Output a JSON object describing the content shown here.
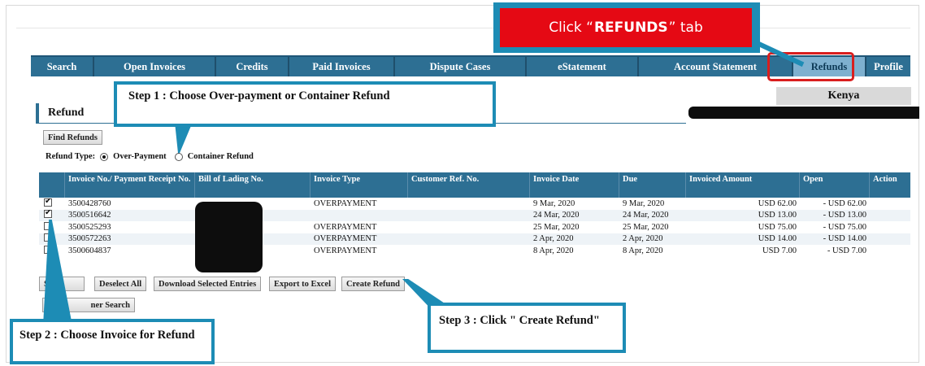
{
  "tabs": [
    "Search",
    "Open Invoices",
    "Credits",
    "Paid Invoices",
    "Dispute Cases",
    "eStatement",
    "Account Statement",
    "Refunds",
    "Profile"
  ],
  "callouts": {
    "top_prefix": "Click “",
    "top_strong": "REFUNDS",
    "top_suffix": "” tab",
    "step1": "Step 1 : Choose Over-payment or Container Refund",
    "step2": "Step 2 : Choose Invoice for Refund",
    "step3": "Step 3 : Click \" Create Refund\""
  },
  "page": {
    "title": "Refund",
    "country": "Kenya",
    "find_button": "Find Refunds",
    "refund_type_label": "Refund Type:",
    "option_overpayment": "Over-Payment",
    "option_container": "Container Refund"
  },
  "table": {
    "headers": [
      "Invoice No./ Payment Receipt No.",
      "Bill of Lading No.",
      "Invoice Type",
      "Customer Ref. No.",
      "Invoice Date",
      "Due",
      "Invoiced Amount",
      "Open",
      "Action"
    ],
    "rows": [
      {
        "checked": true,
        "invoice": "3500428760",
        "type": "OVERPAYMENT",
        "date": "9 Mar, 2020",
        "due": "9 Mar, 2020",
        "amount": "USD 62.00",
        "open": "- USD 62.00"
      },
      {
        "checked": true,
        "invoice": "3500516642",
        "type": "",
        "date": "24 Mar, 2020",
        "due": "24 Mar, 2020",
        "amount": "USD 13.00",
        "open": "- USD 13.00"
      },
      {
        "checked": false,
        "invoice": "3500525293",
        "type": "OVERPAYMENT",
        "date": "25 Mar, 2020",
        "due": "25 Mar, 2020",
        "amount": "USD 75.00",
        "open": "- USD 75.00"
      },
      {
        "checked": false,
        "invoice": "3500572263",
        "type": "OVERPAYMENT",
        "date": "2 Apr, 2020",
        "due": "2 Apr, 2020",
        "amount": "USD 14.00",
        "open": "- USD 14.00"
      },
      {
        "checked": false,
        "invoice": "3500604837",
        "type": "OVERPAYMENT",
        "date": "8 Apr, 2020",
        "due": "8 Apr, 2020",
        "amount": "USD 7.00",
        "open": "- USD 7.00"
      }
    ]
  },
  "buttons": {
    "select_all": "S",
    "deselect_all": "Deselect All",
    "download": "Download Selected Entries",
    "export": "Export to Excel",
    "create": "Create Refund",
    "new_search": "ner Search"
  }
}
